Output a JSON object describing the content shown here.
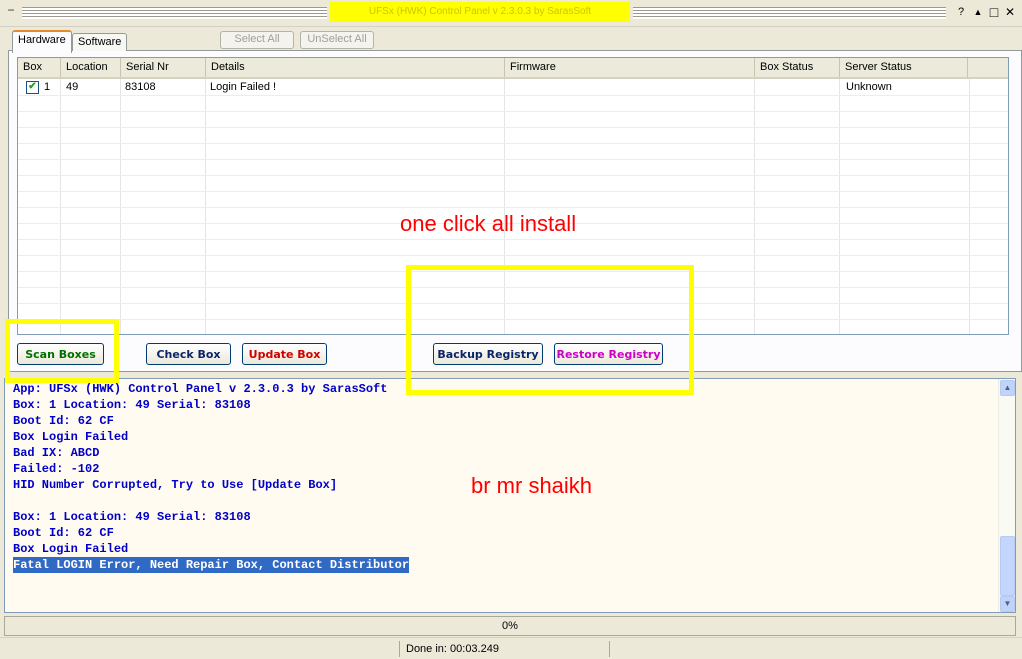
{
  "window": {
    "title": "UFSx (HWK) Control Panel v 2.3.0.3 by SarasSoft",
    "sys_menu_icon": "minus-glyph",
    "help_glyph": "?",
    "restore_glyph": "▲",
    "maximize_glyph": "□",
    "close_glyph": "✕"
  },
  "tabs": [
    {
      "label": "Hardware",
      "active": true
    },
    {
      "label": "Software",
      "active": false
    }
  ],
  "toolbar": {
    "select_all": "Select All",
    "unselect_all": "UnSelect All"
  },
  "listview": {
    "columns": [
      "Box",
      "Location",
      "Serial Nr",
      "Details",
      "Firmware",
      "Box Status",
      "Server Status"
    ],
    "rows": [
      {
        "checked": true,
        "box": "1",
        "location": "49",
        "serial": "83108",
        "details": "Login Failed !",
        "firmware": "",
        "box_status": "",
        "server_status": "Unknown"
      }
    ]
  },
  "buttons": {
    "scan_boxes": "Scan Boxes",
    "check_box": "Check Box",
    "update_box": "Update Box",
    "backup_registry": "Backup Registry",
    "restore_registry": "Restore Registry"
  },
  "button_colors": {
    "scan_boxes": "#007000",
    "check_box": "#0a246a",
    "update_box": "#d00000",
    "backup_registry": "#0a246a",
    "restore_registry": "#cc00cc"
  },
  "overlays": {
    "one_click": "one click all install",
    "credit": "br mr shaikh",
    "color": "#ff0000",
    "highlight_color": "#ffff00"
  },
  "log": [
    "App: UFSx (HWK) Control Panel v 2.3.0.3 by SarasSoft",
    "Box: 1 Location: 49 Serial: 83108",
    "Boot Id: 62 CF",
    "Box Login Failed",
    "Bad IX: ABCD",
    "Failed: -102",
    "HID Number Corrupted, Try to Use [Update Box]",
    "",
    "Box: 1 Location: 49 Serial: 83108",
    "Boot Id: 62 CF",
    "Box Login Failed",
    "Fatal LOGIN Error, Need Repair Box, Contact Distributor"
  ],
  "progress": {
    "text": "0%",
    "value": 0
  },
  "status": {
    "done": "Done in: 00:03.249"
  }
}
